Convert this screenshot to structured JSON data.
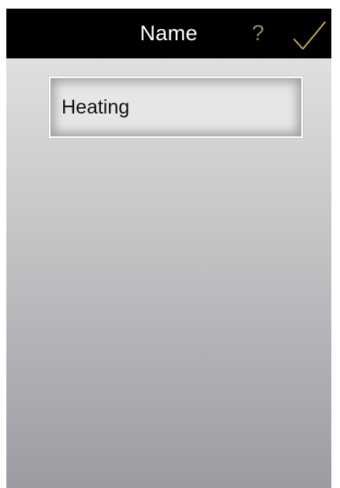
{
  "header": {
    "title": "Name",
    "help_label": "?",
    "confirm_icon": "checkmark-icon"
  },
  "form": {
    "name_value": "Heating"
  },
  "colors": {
    "header_bg": "#000000",
    "title_text": "#ffffff",
    "help_accent": "#8f8a66",
    "checkmark": "#c9a95a"
  }
}
